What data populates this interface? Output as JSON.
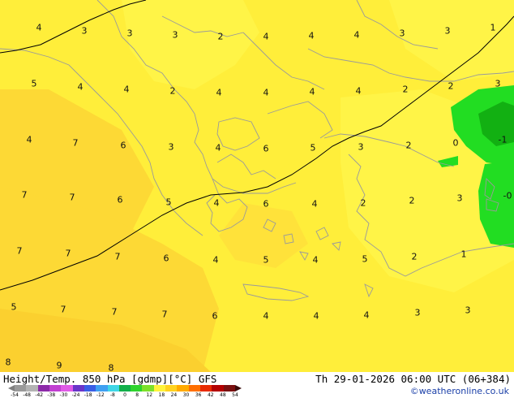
{
  "footer": {
    "title_left": "Height/Temp. 850 hPa [gdmp][°C] GFS",
    "title_right": "Th 29-01-2026 06:00 UTC (06+384)",
    "credit": "©weatheronline.co.uk",
    "scale_labels": [
      "-54",
      "-48",
      "-42",
      "-38",
      "-30",
      "-24",
      "-18",
      "-12",
      "-8",
      "0",
      "8",
      "12",
      "18",
      "24",
      "30",
      "36",
      "42",
      "48",
      "54"
    ],
    "scale_colors": [
      "#9a9a9a",
      "#b3b3b3",
      "#8c2aa8",
      "#c13fd1",
      "#e05be6",
      "#6a35c9",
      "#3a5ee6",
      "#3fa0f2",
      "#3fd6e6",
      "#12b04a",
      "#2ed42e",
      "#7de02a",
      "#fff33b",
      "#ffd21f",
      "#ffaa00",
      "#ff6f00",
      "#e82a00",
      "#b30000",
      "#7a1010"
    ]
  },
  "map": {
    "colors": {
      "yellow": "#ffee3a",
      "light_yellow": "#fff447",
      "orange_yellow": "#fdd935",
      "deep_orange": "#fbd02f",
      "green": "#22dd22",
      "dark_green": "#12b012",
      "border": "#9a9a9a",
      "contour": "#000000"
    },
    "temperature_labels": [
      "4",
      "3",
      "3",
      "3",
      "2",
      "4",
      "4",
      "4",
      "3",
      "3",
      "1",
      "5",
      "4",
      "4",
      "2",
      "4",
      "4",
      "4",
      "4",
      "2",
      "2",
      "3",
      "4",
      "7",
      "6",
      "3",
      "4",
      "6",
      "5",
      "3",
      "2",
      "0",
      "-1",
      "7",
      "7",
      "6",
      "5",
      "4",
      "6",
      "4",
      "2",
      "2",
      "3",
      "-0",
      "7",
      "7",
      "7",
      "6",
      "4",
      "5",
      "4",
      "5",
      "2",
      "1",
      "5",
      "7",
      "7",
      "7",
      "6",
      "4",
      "4",
      "4",
      "3",
      "3",
      "8",
      "9",
      "8"
    ]
  }
}
